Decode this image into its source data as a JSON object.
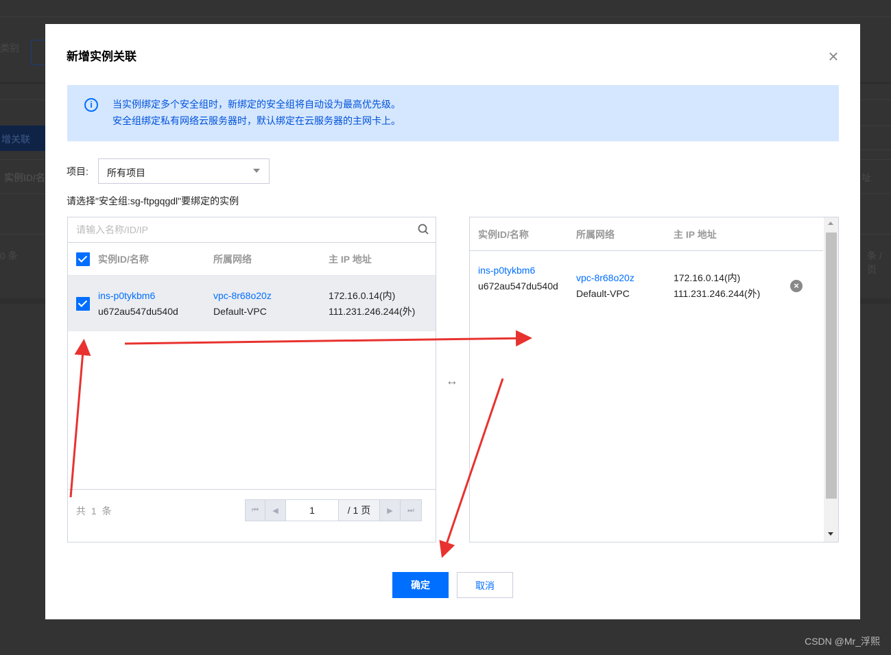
{
  "background": {
    "category_label": "类别",
    "add_button": "增关联",
    "col_instance": "实例ID/名",
    "total_fragment": "0 条",
    "col_ip_fragment": "址",
    "per_page_fragment": "条 / 页"
  },
  "modal": {
    "title": "新增实例关联",
    "notice": [
      "当实例绑定多个安全组时，新绑定的安全组将自动设为最高优先级。",
      "安全组绑定私有网络云服务器时，默认绑定在云服务器的主网卡上。"
    ],
    "project_label": "项目:",
    "project_value": "所有项目",
    "hint": "请选择\"安全组:sg-ftpgqgdl\"要绑定的实例",
    "left": {
      "search_placeholder": "请输入名称/ID/IP",
      "columns": [
        "实例ID/名称",
        "所属网络",
        "主 IP 地址"
      ],
      "rows": [
        {
          "id": "ins-p0tykbm6",
          "name": "u672au547du540d",
          "vpc_id": "vpc-8r68o20z",
          "vpc_name": "Default-VPC",
          "ip_private": "172.16.0.14(内)",
          "ip_public": "111.231.246.244(外)",
          "checked": true
        }
      ],
      "total": "共 1 条",
      "page": "1",
      "page_total": "/ 1 页"
    },
    "right": {
      "columns": [
        "实例ID/名称",
        "所属网络",
        "主 IP 地址"
      ],
      "rows": [
        {
          "id": "ins-p0tykbm6",
          "name": "u672au547du540d",
          "vpc_id": "vpc-8r68o20z",
          "vpc_name": "Default-VPC",
          "ip_private": "172.16.0.14(内)",
          "ip_public": "111.231.246.244(外)"
        }
      ]
    },
    "ok_label": "确定",
    "cancel_label": "取消"
  },
  "watermark": "CSDN @Mr_浮熙",
  "colors": {
    "accent": "#006eff",
    "notice_bg": "#d5e7fe",
    "annotation": "#e8322f"
  }
}
